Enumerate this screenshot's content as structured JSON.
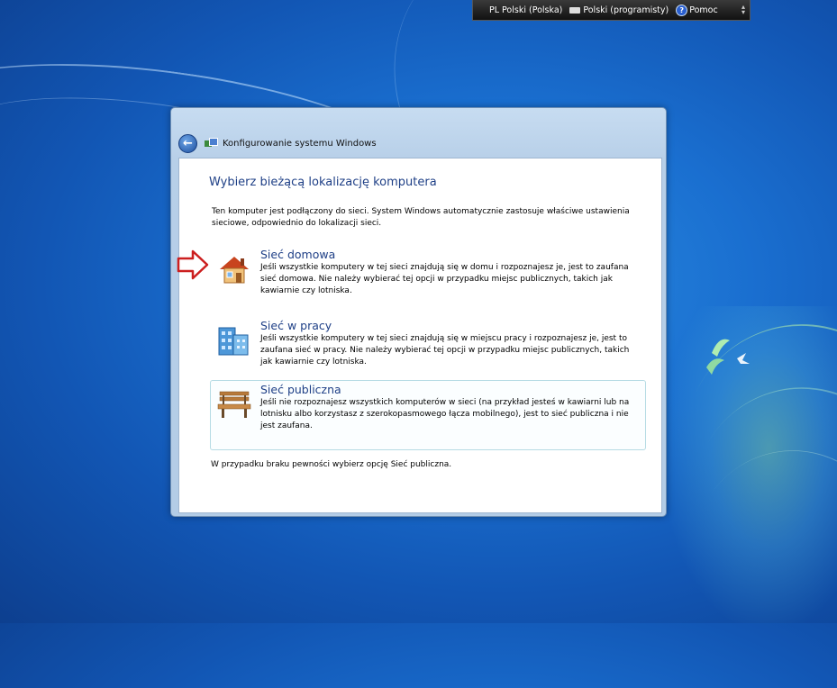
{
  "language_bar": {
    "input_language": "PL Polski (Polska)",
    "keyboard_layout": "Polski (programisty)",
    "help_label": "Pomoc"
  },
  "dialog": {
    "title": "Konfigurowanie systemu Windows",
    "heading": "Wybierz bieżącą lokalizację komputera",
    "intro": "Ten komputer jest podłączony do sieci. System Windows automatycznie zastosuje właściwe ustawienia sieciowe, odpowiednio do lokalizacji sieci.",
    "options": [
      {
        "title": "Sieć domowa",
        "description": "Jeśli wszystkie komputery w tej sieci znajdują się w domu i rozpoznajesz je, jest to zaufana sieć domowa. Nie należy wybierać tej opcji w przypadku miejsc publicznych, takich jak kawiarnie czy lotniska.",
        "icon": "house-icon"
      },
      {
        "title": "Sieć w pracy",
        "description": "Jeśli wszystkie komputery w tej sieci znajdują się w miejscu pracy i rozpoznajesz je, jest to zaufana sieć w pracy. Nie należy wybierać tej opcji w przypadku miejsc publicznych, takich jak kawiarnie czy lotniska.",
        "icon": "office-building-icon"
      },
      {
        "title": "Sieć publiczna",
        "description": "Jeśli nie rozpoznajesz wszystkich komputerów w sieci (na przykład jesteś w kawiarni lub na lotnisku albo korzystasz z szerokopasmowego łącza mobilnego), jest to sieć publiczna i nie jest zaufana.",
        "icon": "park-bench-icon"
      }
    ],
    "footer_note": "W przypadku braku pewności wybierz opcję Sieć publiczna."
  },
  "colors": {
    "heading": "#1e3f86",
    "selected_border": "#b6dbe4",
    "arrow": "#cc1f1f"
  }
}
